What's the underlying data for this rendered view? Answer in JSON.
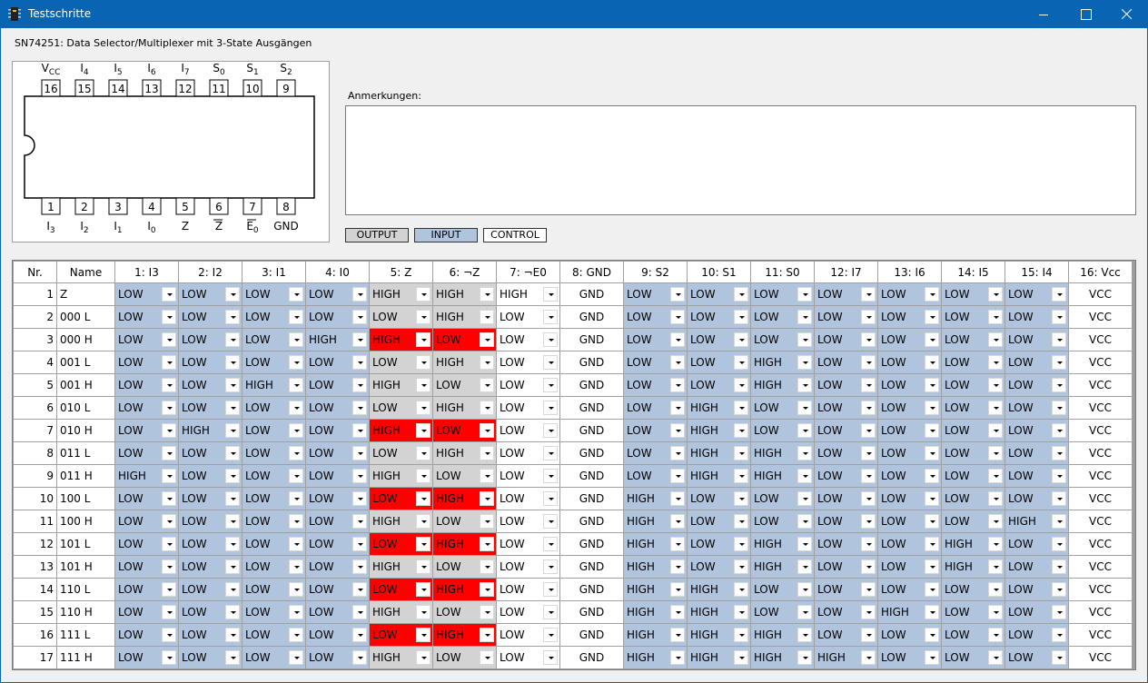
{
  "window": {
    "title": "Testschritte"
  },
  "chip": {
    "name": "SN74251: Data Selector/Multiplexer mit 3-State Ausgängen",
    "top_pins": [
      {
        "num": "16",
        "label": "V",
        "sub": "CC"
      },
      {
        "num": "15",
        "label": "I",
        "sub": "4"
      },
      {
        "num": "14",
        "label": "I",
        "sub": "5"
      },
      {
        "num": "13",
        "label": "I",
        "sub": "6"
      },
      {
        "num": "12",
        "label": "I",
        "sub": "7"
      },
      {
        "num": "11",
        "label": "S",
        "sub": "0"
      },
      {
        "num": "10",
        "label": "S",
        "sub": "1"
      },
      {
        "num": "9",
        "label": "S",
        "sub": "2"
      }
    ],
    "bottom_pins": [
      {
        "num": "1",
        "label": "I",
        "sub": "3"
      },
      {
        "num": "2",
        "label": "I",
        "sub": "2"
      },
      {
        "num": "3",
        "label": "I",
        "sub": "1"
      },
      {
        "num": "4",
        "label": "I",
        "sub": "0"
      },
      {
        "num": "5",
        "label": "Z",
        "sub": ""
      },
      {
        "num": "6",
        "label": "Z",
        "sub": "",
        "overline": true
      },
      {
        "num": "7",
        "label": "E",
        "sub": "0",
        "overline": true
      },
      {
        "num": "8",
        "label": "GND",
        "sub": ""
      }
    ]
  },
  "notes": {
    "label": "Anmerkungen:",
    "value": ""
  },
  "legend": {
    "output": "OUTPUT",
    "input": "INPUT",
    "control": "CONTROL"
  },
  "colors": {
    "input": "#b0c4de",
    "output": "#d3d3d3",
    "error": "#ff0000",
    "titlebar": "#0a64b4"
  },
  "table": {
    "headers": [
      "Nr.",
      "Name",
      "1: I3",
      "2: I2",
      "3: I1",
      "4: I0",
      "5: Z",
      "6: ¬Z",
      "7: ¬E0",
      "8: GND",
      "9: S2",
      "10: S1",
      "11: S0",
      "12: I7",
      "13: I6",
      "14: I5",
      "15: I4",
      "16: Vcc"
    ],
    "column_types": [
      "nr",
      "name",
      "in",
      "in",
      "in",
      "in",
      "out",
      "out",
      "ctrl",
      "const",
      "in",
      "in",
      "in",
      "in",
      "in",
      "in",
      "in",
      "const"
    ],
    "rows": [
      {
        "nr": "1",
        "name": "Z",
        "cells": [
          "LOW",
          "LOW",
          "LOW",
          "LOW",
          "HIGH",
          "HIGH",
          "HIGH",
          "GND",
          "LOW",
          "LOW",
          "LOW",
          "LOW",
          "LOW",
          "LOW",
          "LOW",
          "VCC"
        ],
        "err": []
      },
      {
        "nr": "2",
        "name": "000 L",
        "cells": [
          "LOW",
          "LOW",
          "LOW",
          "LOW",
          "LOW",
          "HIGH",
          "LOW",
          "GND",
          "LOW",
          "LOW",
          "LOW",
          "LOW",
          "LOW",
          "LOW",
          "LOW",
          "VCC"
        ],
        "err": []
      },
      {
        "nr": "3",
        "name": "000 H",
        "cells": [
          "LOW",
          "LOW",
          "LOW",
          "HIGH",
          "HIGH",
          "LOW",
          "LOW",
          "GND",
          "LOW",
          "LOW",
          "LOW",
          "LOW",
          "LOW",
          "LOW",
          "LOW",
          "VCC"
        ],
        "err": [
          4,
          5
        ]
      },
      {
        "nr": "4",
        "name": "001 L",
        "cells": [
          "LOW",
          "LOW",
          "LOW",
          "LOW",
          "LOW",
          "HIGH",
          "LOW",
          "GND",
          "LOW",
          "LOW",
          "HIGH",
          "LOW",
          "LOW",
          "LOW",
          "LOW",
          "VCC"
        ],
        "err": []
      },
      {
        "nr": "5",
        "name": "001 H",
        "cells": [
          "LOW",
          "LOW",
          "HIGH",
          "LOW",
          "HIGH",
          "LOW",
          "LOW",
          "GND",
          "LOW",
          "LOW",
          "HIGH",
          "LOW",
          "LOW",
          "LOW",
          "LOW",
          "VCC"
        ],
        "err": []
      },
      {
        "nr": "6",
        "name": "010 L",
        "cells": [
          "LOW",
          "LOW",
          "LOW",
          "LOW",
          "LOW",
          "HIGH",
          "LOW",
          "GND",
          "LOW",
          "HIGH",
          "LOW",
          "LOW",
          "LOW",
          "LOW",
          "LOW",
          "VCC"
        ],
        "err": []
      },
      {
        "nr": "7",
        "name": "010 H",
        "cells": [
          "LOW",
          "HIGH",
          "LOW",
          "LOW",
          "HIGH",
          "LOW",
          "LOW",
          "GND",
          "LOW",
          "HIGH",
          "LOW",
          "LOW",
          "LOW",
          "LOW",
          "LOW",
          "VCC"
        ],
        "err": [
          4,
          5
        ]
      },
      {
        "nr": "8",
        "name": "011 L",
        "cells": [
          "LOW",
          "LOW",
          "LOW",
          "LOW",
          "LOW",
          "HIGH",
          "LOW",
          "GND",
          "LOW",
          "HIGH",
          "HIGH",
          "LOW",
          "LOW",
          "LOW",
          "LOW",
          "VCC"
        ],
        "err": []
      },
      {
        "nr": "9",
        "name": "011 H",
        "cells": [
          "HIGH",
          "LOW",
          "LOW",
          "LOW",
          "HIGH",
          "LOW",
          "LOW",
          "GND",
          "LOW",
          "HIGH",
          "HIGH",
          "LOW",
          "LOW",
          "LOW",
          "LOW",
          "VCC"
        ],
        "err": []
      },
      {
        "nr": "10",
        "name": "100 L",
        "cells": [
          "LOW",
          "LOW",
          "LOW",
          "LOW",
          "LOW",
          "HIGH",
          "LOW",
          "GND",
          "HIGH",
          "LOW",
          "LOW",
          "LOW",
          "LOW",
          "LOW",
          "LOW",
          "VCC"
        ],
        "err": [
          4,
          5
        ]
      },
      {
        "nr": "11",
        "name": "100 H",
        "cells": [
          "LOW",
          "LOW",
          "LOW",
          "LOW",
          "HIGH",
          "LOW",
          "LOW",
          "GND",
          "HIGH",
          "LOW",
          "LOW",
          "LOW",
          "LOW",
          "LOW",
          "HIGH",
          "VCC"
        ],
        "err": []
      },
      {
        "nr": "12",
        "name": "101 L",
        "cells": [
          "LOW",
          "LOW",
          "LOW",
          "LOW",
          "LOW",
          "HIGH",
          "LOW",
          "GND",
          "HIGH",
          "LOW",
          "HIGH",
          "LOW",
          "LOW",
          "HIGH",
          "LOW",
          "VCC"
        ],
        "err": [
          4,
          5
        ]
      },
      {
        "nr": "13",
        "name": "101 H",
        "cells": [
          "LOW",
          "LOW",
          "LOW",
          "LOW",
          "HIGH",
          "LOW",
          "LOW",
          "GND",
          "HIGH",
          "LOW",
          "HIGH",
          "LOW",
          "LOW",
          "HIGH",
          "LOW",
          "VCC"
        ],
        "err": []
      },
      {
        "nr": "14",
        "name": "110 L",
        "cells": [
          "LOW",
          "LOW",
          "LOW",
          "LOW",
          "LOW",
          "HIGH",
          "LOW",
          "GND",
          "HIGH",
          "HIGH",
          "LOW",
          "LOW",
          "LOW",
          "LOW",
          "LOW",
          "VCC"
        ],
        "err": [
          4,
          5
        ]
      },
      {
        "nr": "15",
        "name": "110 H",
        "cells": [
          "LOW",
          "LOW",
          "LOW",
          "LOW",
          "HIGH",
          "LOW",
          "LOW",
          "GND",
          "HIGH",
          "HIGH",
          "LOW",
          "LOW",
          "HIGH",
          "LOW",
          "LOW",
          "VCC"
        ],
        "err": []
      },
      {
        "nr": "16",
        "name": "111 L",
        "cells": [
          "LOW",
          "LOW",
          "LOW",
          "LOW",
          "LOW",
          "HIGH",
          "LOW",
          "GND",
          "HIGH",
          "HIGH",
          "HIGH",
          "LOW",
          "LOW",
          "LOW",
          "LOW",
          "VCC"
        ],
        "err": [
          4,
          5
        ]
      },
      {
        "nr": "17",
        "name": "111 H",
        "cells": [
          "LOW",
          "LOW",
          "LOW",
          "LOW",
          "HIGH",
          "LOW",
          "LOW",
          "GND",
          "HIGH",
          "HIGH",
          "HIGH",
          "HIGH",
          "LOW",
          "LOW",
          "LOW",
          "VCC"
        ],
        "err": []
      }
    ]
  }
}
